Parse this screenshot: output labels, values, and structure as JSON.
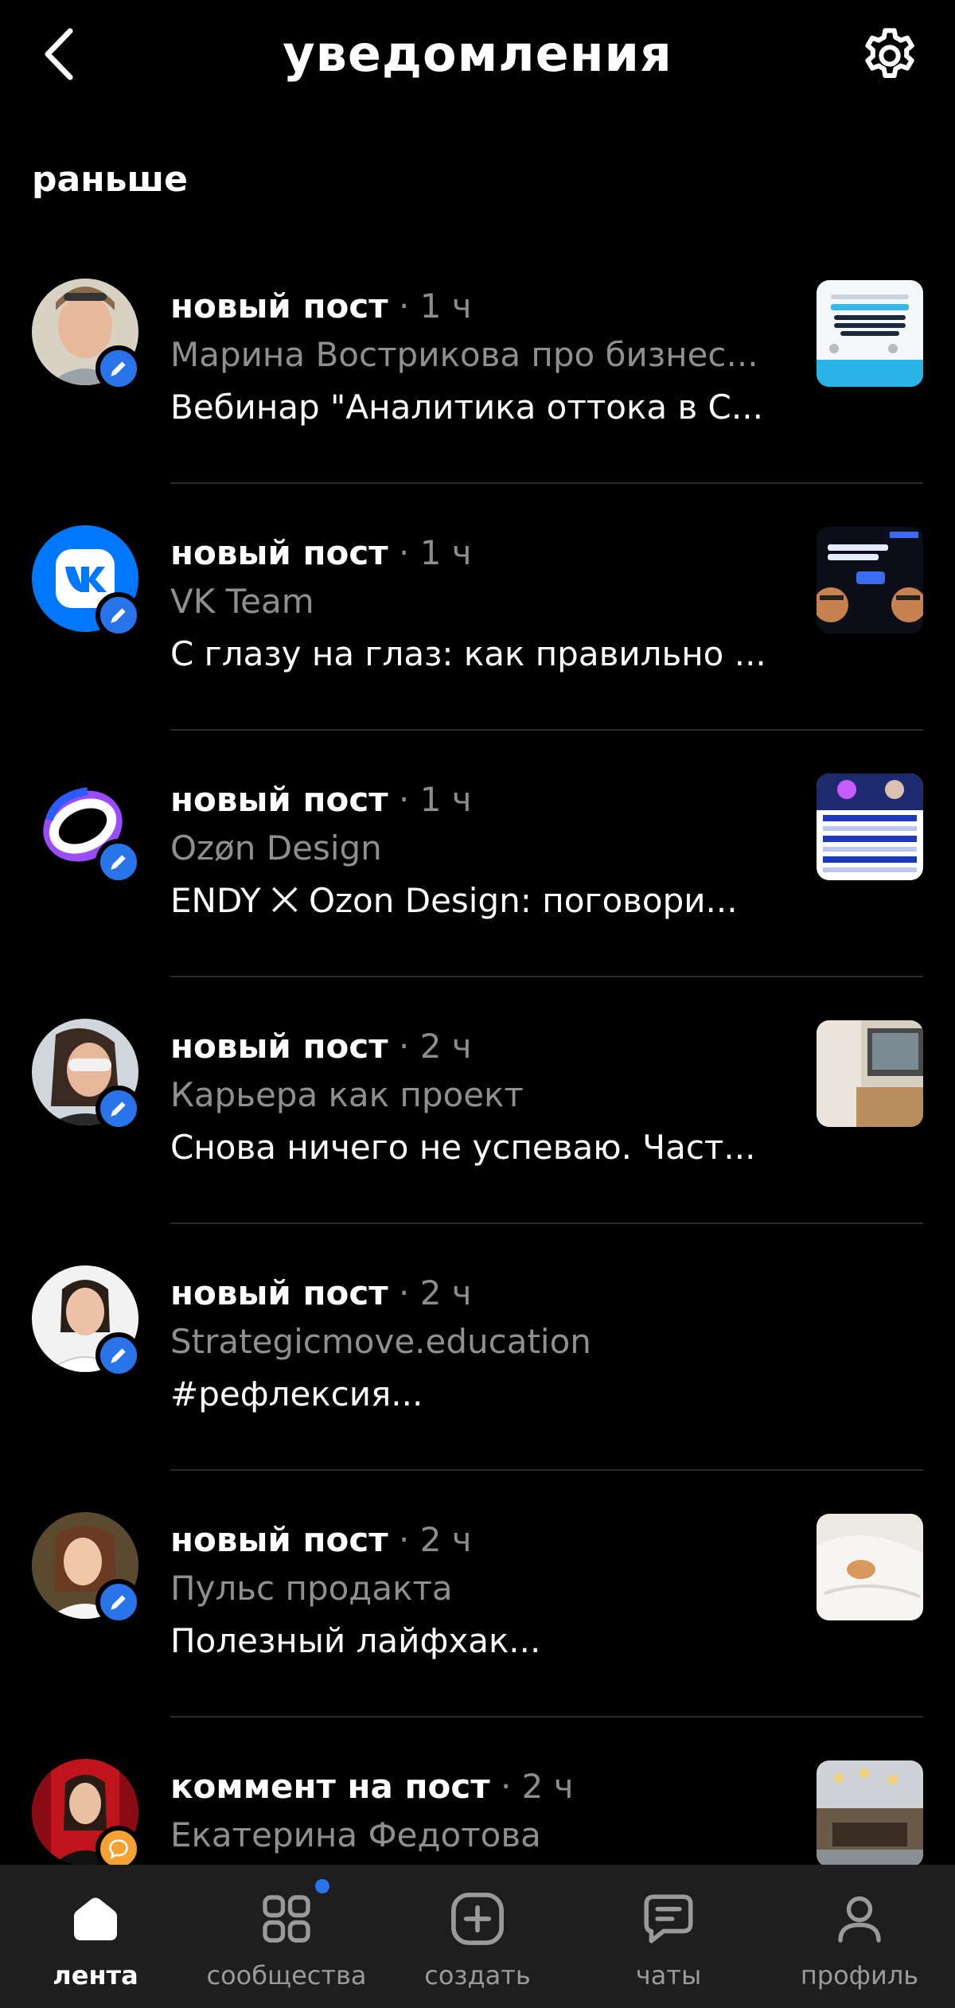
{
  "header": {
    "title": "уведомления",
    "back_icon": "chevron-left-icon",
    "settings_icon": "gear-icon"
  },
  "section": {
    "title": "раньше"
  },
  "notifications": [
    {
      "type_label": "новый пост",
      "separator": "·",
      "time": "1 ч",
      "source": "Марина Вострикова про бизнес...",
      "preview": "Вебинар \"Аналитика оттока в С...",
      "badge_icon": "pencil-icon"
    },
    {
      "type_label": "новый пост",
      "separator": "·",
      "time": "1 ч",
      "source": "VK Team",
      "preview": "С глазу на глаз: как правильно ...",
      "badge_icon": "pencil-icon"
    },
    {
      "type_label": "новый пост",
      "separator": "·",
      "time": "1 ч",
      "source": "Ozøn Design",
      "preview": "ENDY ⨉ Ozon Design: поговори...",
      "badge_icon": "pencil-icon"
    },
    {
      "type_label": "новый пост",
      "separator": "·",
      "time": "2 ч",
      "source": "Карьера как проект",
      "preview": "Снова ничего не успеваю. Част...",
      "badge_icon": "pencil-icon"
    },
    {
      "type_label": "новый пост",
      "separator": "·",
      "time": "2 ч",
      "source": "Strategicmove.education",
      "preview": "#рефлексия...",
      "badge_icon": "pencil-icon"
    },
    {
      "type_label": "новый пост",
      "separator": "·",
      "time": "2 ч",
      "source": "Пульс продакта",
      "preview": "Полезный лайфхак...",
      "badge_icon": "pencil-icon"
    },
    {
      "type_label": "коммент на пост",
      "separator": "·",
      "time": "2 ч",
      "source": "Екатерина Федотова",
      "preview": "",
      "badge_icon": "comment-icon"
    }
  ],
  "bottom_nav": {
    "items": [
      {
        "label": "лента",
        "icon": "home-icon",
        "active": true
      },
      {
        "label": "сообщества",
        "icon": "grid-icon",
        "active": false,
        "has_dot": true
      },
      {
        "label": "создать",
        "icon": "plus-square-icon",
        "active": false
      },
      {
        "label": "чаты",
        "icon": "chat-icon",
        "active": false
      },
      {
        "label": "профиль",
        "icon": "profile-icon",
        "active": false
      }
    ]
  },
  "colors": {
    "background": "#000000",
    "accent": "#2a74ea",
    "comment_badge": "#f4a233",
    "secondary_text": "#8f8f8f",
    "nav_background": "#1e1e1e"
  }
}
